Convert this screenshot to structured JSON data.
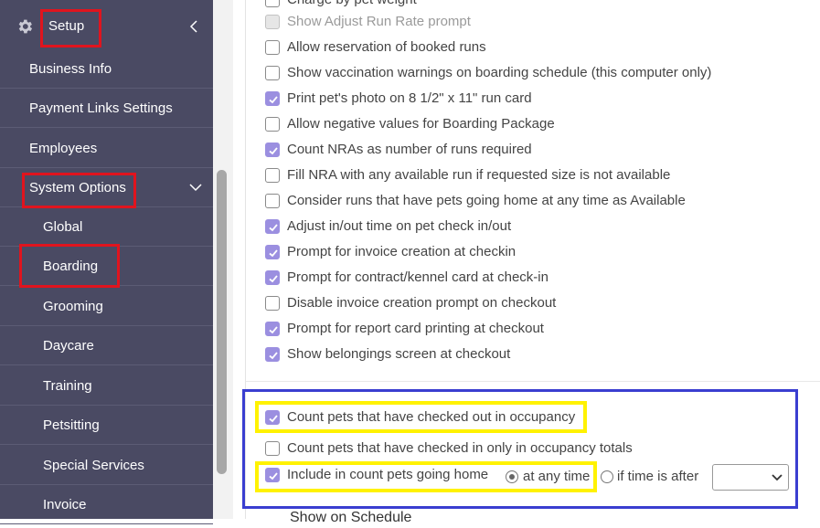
{
  "sidebar": {
    "header": {
      "label": "Setup"
    },
    "items": [
      {
        "label": "Business Info"
      },
      {
        "label": "Payment Links Settings"
      },
      {
        "label": "Employees"
      },
      {
        "label": "System Options"
      }
    ],
    "sub_items": [
      {
        "label": "Global"
      },
      {
        "label": "Boarding"
      },
      {
        "label": "Grooming"
      },
      {
        "label": "Daycare"
      },
      {
        "label": "Training"
      },
      {
        "label": "Petsitting"
      },
      {
        "label": "Special Services"
      },
      {
        "label": "Invoice"
      }
    ]
  },
  "options": [
    {
      "label": "Charge by pet weight",
      "checked": false
    },
    {
      "label": "Show Adjust Run Rate prompt",
      "checked": false,
      "disabled": true
    },
    {
      "label": "Allow reservation of booked runs",
      "checked": false
    },
    {
      "label": "Show vaccination warnings on boarding schedule (this computer only)",
      "checked": false
    },
    {
      "label": "Print pet's photo on 8 1/2\" x 11\" run card",
      "checked": true
    },
    {
      "label": "Allow negative values for Boarding Package",
      "checked": false
    },
    {
      "label": "Count NRAs as number of runs required",
      "checked": true
    },
    {
      "label": "Fill NRA with any available run if requested size is not available",
      "checked": false
    },
    {
      "label": "Consider runs that have pets going home at any time as Available",
      "checked": false
    },
    {
      "label": "Adjust in/out time on pet check in/out",
      "checked": true
    },
    {
      "label": "Prompt for invoice creation at checkin",
      "checked": true
    },
    {
      "label": "Prompt for contract/kennel card at check-in",
      "checked": true
    },
    {
      "label": "Disable invoice creation prompt on checkout",
      "checked": false
    },
    {
      "label": "Prompt for report card printing at checkout",
      "checked": true
    },
    {
      "label": "Show belongings screen at checkout",
      "checked": true
    }
  ],
  "occupancy": {
    "count_checked_out": {
      "label": "Count pets that have checked out in occupancy",
      "checked": true
    },
    "count_checked_in_only": {
      "label": "Count pets that have checked in only in occupancy totals",
      "checked": false
    },
    "include_going_home": {
      "label": "Include in count pets going home",
      "checked": true,
      "radio_any_time": "at any time",
      "radio_if_after": "if time is after",
      "selected": "at any time",
      "time_value": ""
    }
  },
  "next_section": {
    "label": "Show on Schedule"
  },
  "colors": {
    "accent": "#9b8fe0",
    "sidebar_bg": "#4a4a63",
    "highlight_red": "#e0141e",
    "highlight_yellow": "#fff200",
    "highlight_blue": "#3a3ed0"
  }
}
